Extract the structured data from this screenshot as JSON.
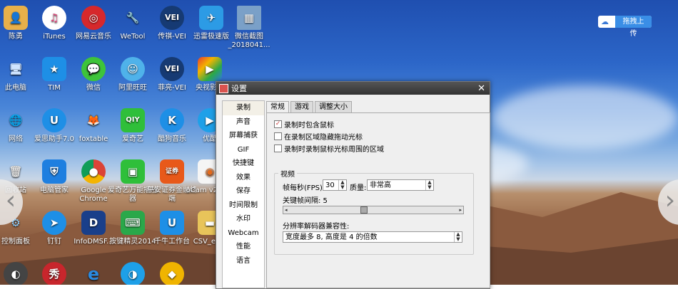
{
  "desktop": {
    "icons_row1": [
      "陈勇",
      "iTunes",
      "网易云音乐",
      "WeTool",
      "传祺-VEI",
      "迅雷极速版",
      "微信截图_2018041..."
    ],
    "icons_row2": [
      "此电脑",
      "TIM",
      "微信",
      "阿里旺旺",
      "菲亮-VEI",
      "央视影音"
    ],
    "icons_row3": [
      "网络",
      "爱思助手7.0",
      "foxtable",
      "爱奇艺",
      "酷狗音乐",
      "优酷"
    ],
    "icons_row4": [
      "回收站",
      "电脑管家",
      "Google Chrome",
      "爱奇艺万能播放器",
      "平安证券金融终端",
      "oCam v264.0"
    ],
    "icons_row5": [
      "控制面板",
      "钉钉",
      "InfoDMSF...",
      "按键精灵2014",
      "千牛工作台",
      "CSV_ex..."
    ],
    "top_right_button": "拖拽上传"
  },
  "dialog": {
    "title": "设置",
    "sidebar": [
      "录制",
      "声音",
      "屏幕捕获",
      "GIF",
      "快捷键",
      "效果",
      "保存",
      "时间限制",
      "水印",
      "Webcam",
      "性能",
      "语言"
    ],
    "tabs": [
      "常规",
      "游戏",
      "调整大小"
    ],
    "checkboxes": [
      "录制时包含鼠标",
      "在录制区域隐藏拖动光标",
      "录制时录制鼠标光标周围的区域"
    ],
    "video_group": "视频",
    "fps_label": "帧每秒(FPS):",
    "fps_value": "30",
    "quality_label": "质量:",
    "quality_value": "非常高",
    "keyframe_label": "关键帧间隔: 5",
    "resolution_label": "分辨率解码器兼容性:",
    "resolution_value": "宽度最多 8, 高度是 4 的倍数"
  },
  "colors": {
    "dialog_bg": "#efefef",
    "title_bar": "#3b3b3b",
    "checkbox_check": "#cc4444"
  }
}
